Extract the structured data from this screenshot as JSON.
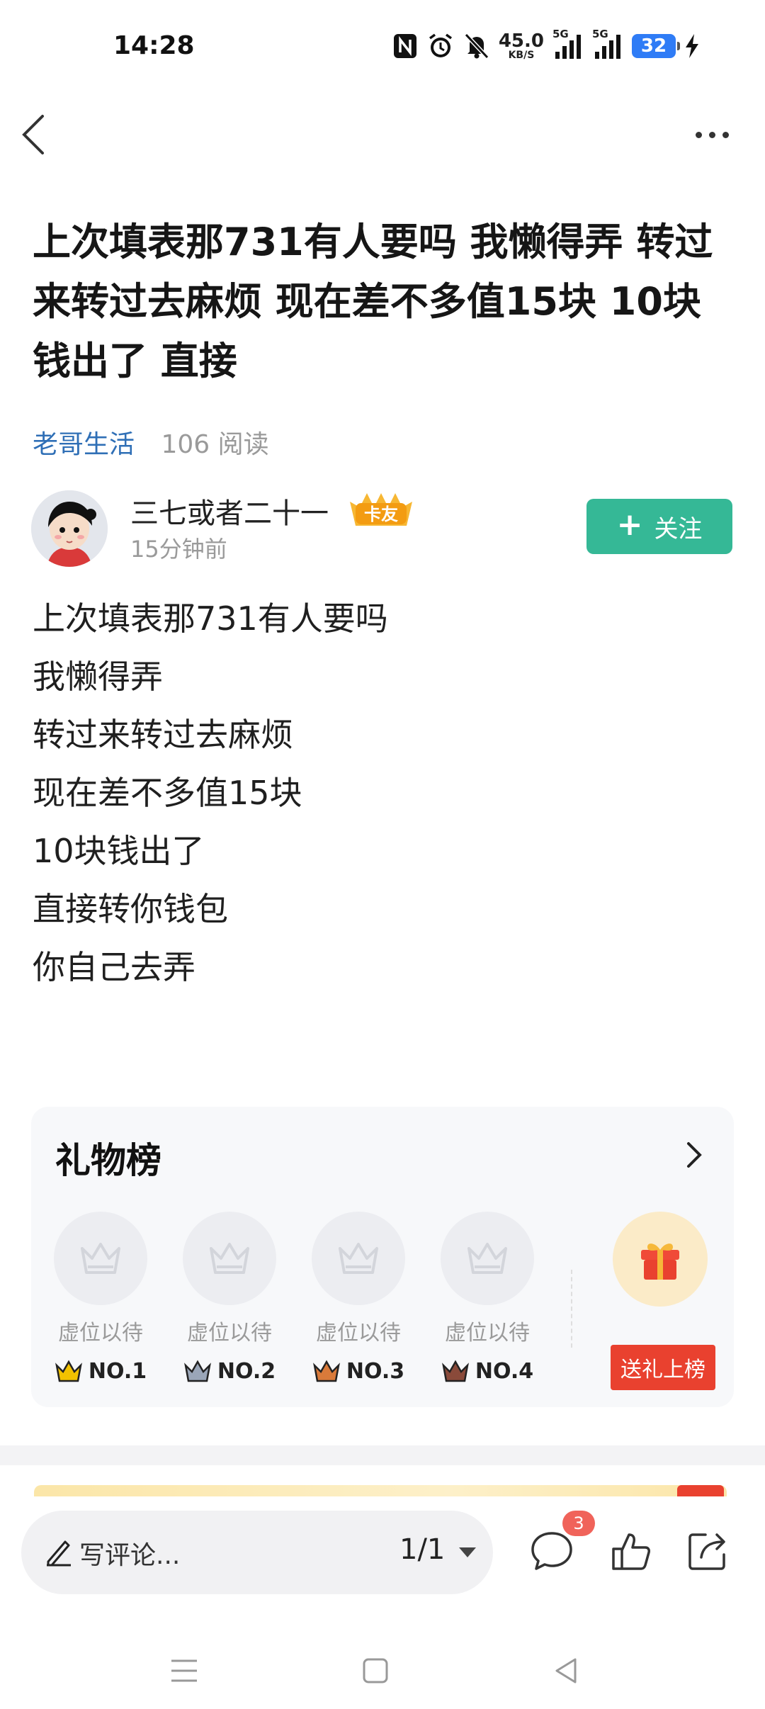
{
  "status_bar": {
    "time": "14:28",
    "net_speed_value": "45.0",
    "net_speed_unit": "KB/S",
    "sim1_label": "5G",
    "sim2_label": "5G",
    "battery": "32",
    "icons": [
      "nfc-icon",
      "alarm-icon",
      "mute-icon",
      "speed-icon",
      "signal-icon",
      "signal-icon",
      "battery-icon",
      "charging-icon"
    ]
  },
  "post": {
    "title": "上次填表那731有人要吗 我懒得弄 转过来转过去麻烦 现在差不多值15块 10块钱出了 直接",
    "group": "老哥生活",
    "reads": "106 阅读",
    "author": {
      "name": "三七或者二十一",
      "badge": "卡友",
      "time": "15分钟前"
    },
    "follow_label": "关注",
    "body_lines": [
      "上次填表那731有人要吗",
      "我懒得弄",
      "转过来转过去麻烦",
      "现在差不多值15块",
      "10块钱出了",
      "直接转你钱包",
      "你自己去弄"
    ]
  },
  "gift_board": {
    "title": "礼物榜",
    "slots": [
      {
        "placeholder": "虚位以待",
        "rank": "NO.1",
        "crown_color": "#f2c200"
      },
      {
        "placeholder": "虚位以待",
        "rank": "NO.2",
        "crown_color": "#9aa6b8"
      },
      {
        "placeholder": "虚位以待",
        "rank": "NO.3",
        "crown_color": "#d97a3a"
      },
      {
        "placeholder": "虚位以待",
        "rank": "NO.4",
        "crown_color": "#8a4a3a"
      }
    ],
    "send_label": "送礼上榜"
  },
  "bottom_bar": {
    "comment_placeholder": "写评论...",
    "page_indicator": "1/1",
    "comment_count": "3"
  },
  "colors": {
    "accent_green": "#35b896",
    "link_blue": "#2f6fb6",
    "gift_red": "#e9412f",
    "badge_red": "#f0635a"
  }
}
